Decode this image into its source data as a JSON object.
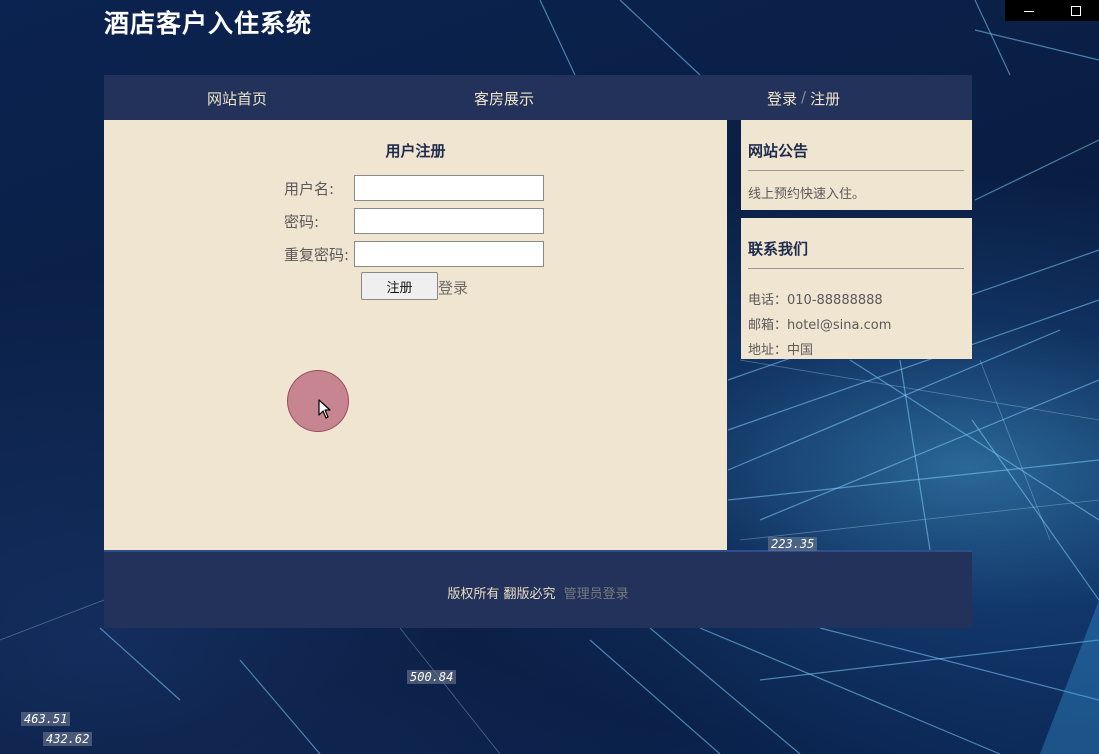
{
  "site": {
    "title": "酒店客户入住系统"
  },
  "window": {
    "minimize_icon": "minimize-icon",
    "maximize_icon": "maximize-icon"
  },
  "nav": {
    "home": "网站首页",
    "rooms": "客房展示",
    "login": "登录",
    "separator": "/",
    "register": "注册"
  },
  "register_form": {
    "title": "用户注册",
    "username_label": "用户名:",
    "password_label": "密码:",
    "repeat_password_label": "重复密码:",
    "username_value": "",
    "password_value": "",
    "repeat_password_value": "",
    "register_button": "注册",
    "login_link": "登录"
  },
  "notice": {
    "title": "网站公告",
    "text": "线上预约快速入住。"
  },
  "contact": {
    "title": "联系我们",
    "phone": "电话：010-88888888",
    "email": "邮箱：hotel@sina.com",
    "address": "地址：中国"
  },
  "footer": {
    "copyright": "版权所有 翻版必究",
    "admin_login": "管理员登录"
  },
  "background_numbers": [
    "223.35",
    "500.84",
    "463.51",
    "432.62"
  ],
  "colors": {
    "nav_bg": "#22325a",
    "panel_bg": "#efe5d1",
    "title_text": "#1f2b4d",
    "cursor_highlight": "#b0506e"
  }
}
